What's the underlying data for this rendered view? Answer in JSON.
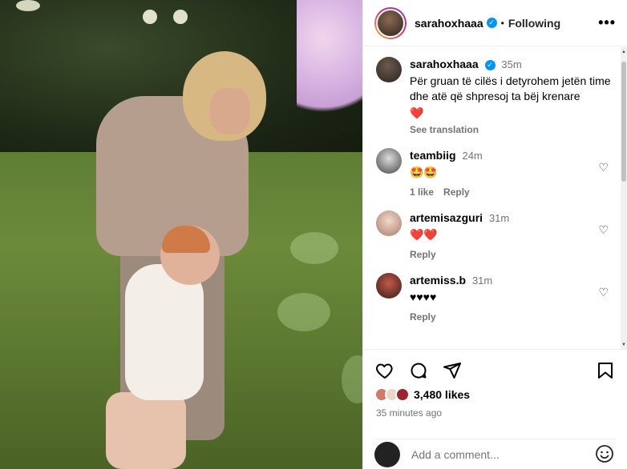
{
  "post": {
    "username": "sarahoxhaaa",
    "dot": "•",
    "follow_status": "Following",
    "more": "•••"
  },
  "caption": {
    "username": "sarahoxhaaa",
    "time": "35m",
    "text": "Për gruan të cilës i detyrohem jetën time dhe atë që shpresoj ta bëj krenare",
    "emoji": "❤️",
    "see_translation": "See translation"
  },
  "comments": [
    {
      "username": "teambiig",
      "time": "24m",
      "text": "🤩🤩",
      "likes": "1 like",
      "reply": "Reply"
    },
    {
      "username": "artemisazguri",
      "time": "31m",
      "text": "❤️❤️",
      "reply": "Reply"
    },
    {
      "username": "artemiss.b",
      "time": "31m",
      "text": "♥♥♥♥",
      "reply": "Reply"
    }
  ],
  "footer": {
    "likes": "3,480 likes",
    "posted_ago": "35 minutes ago",
    "comment_placeholder": "Add a comment..."
  },
  "colors": {
    "verified": "#0095f6",
    "muted": "#737373",
    "heart": "#ed4956"
  },
  "icons": [
    "more-options-icon",
    "verified-badge-icon",
    "heart-icon",
    "comment-icon",
    "share-icon",
    "bookmark-icon",
    "emoji-icon"
  ]
}
